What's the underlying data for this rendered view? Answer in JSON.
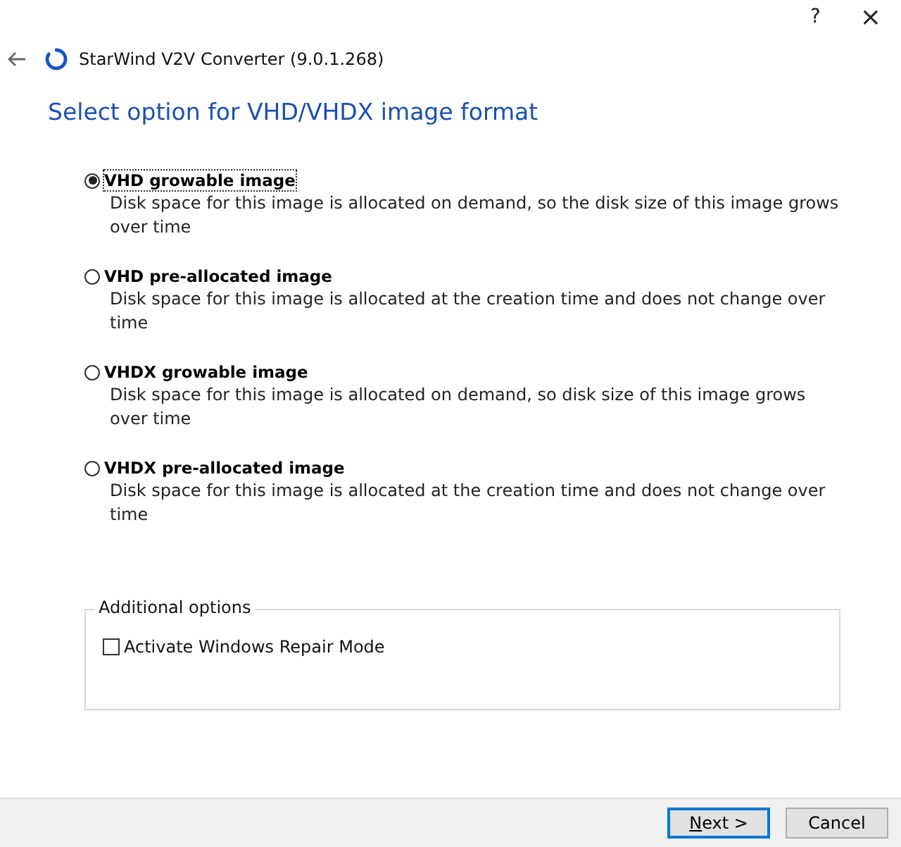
{
  "window": {
    "help": "?",
    "close": "×"
  },
  "header": {
    "title": "StarWind V2V Converter (9.0.1.268)"
  },
  "heading": "Select option for VHD/VHDX image format",
  "options": [
    {
      "label": "VHD growable image",
      "description": "Disk space for this image is allocated on demand, so the disk size of this image grows over time",
      "selected": true
    },
    {
      "label": "VHD pre-allocated image",
      "description": "Disk space for this image is allocated at the creation time and does not change over time",
      "selected": false
    },
    {
      "label": "VHDX growable image",
      "description": "Disk space for this image is allocated on demand, so disk size of this image grows over time",
      "selected": false
    },
    {
      "label": "VHDX pre-allocated image",
      "description": "Disk space for this image is allocated at the creation time and does not change over time",
      "selected": false
    }
  ],
  "additional": {
    "title": "Additional options",
    "checkbox": {
      "label": "Activate Windows Repair Mode",
      "checked": false
    }
  },
  "buttons": [
    {
      "label": "Next >",
      "kind": "default"
    },
    {
      "label": "Cancel",
      "kind": "normal"
    }
  ]
}
